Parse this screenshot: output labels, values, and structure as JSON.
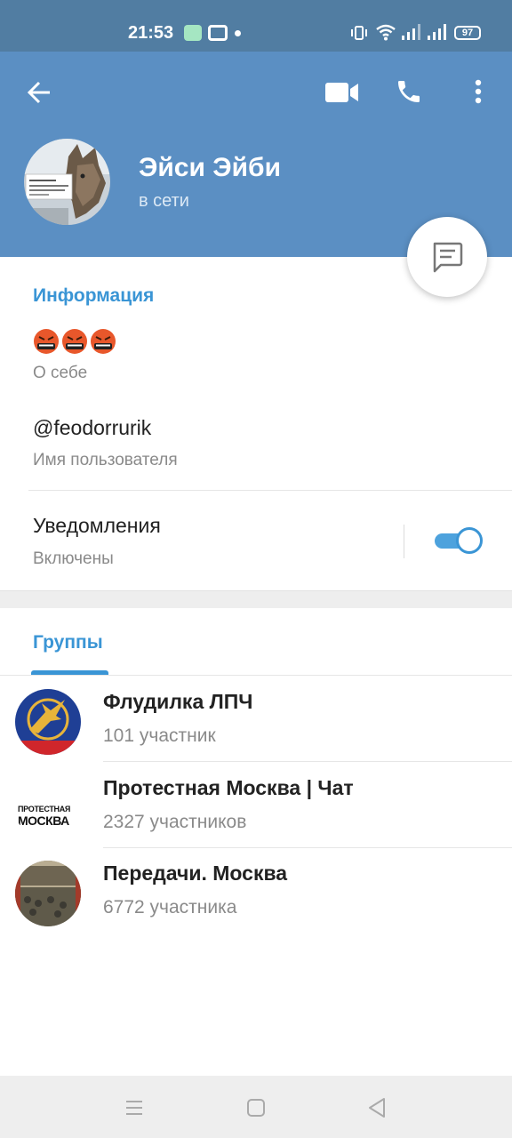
{
  "status_bar": {
    "time": "21:53",
    "battery": "97",
    "icons": [
      "app-notification-icon",
      "app-notification-icon",
      "dot-icon",
      "vibrate-icon",
      "wifi-icon",
      "signal-icon",
      "signal-icon",
      "battery-icon"
    ]
  },
  "header": {
    "icons": [
      "arrow-left-icon",
      "video-camera-icon",
      "phone-icon",
      "more-vertical-icon"
    ],
    "name": "Эйси Эйби",
    "status": "в сети",
    "avatar_icon": "wolf-photo-avatar",
    "fab_icon": "message-icon"
  },
  "info": {
    "title": "Информация",
    "bio_emojis": [
      "angry-face-emoji",
      "angry-face-emoji",
      "angry-face-emoji"
    ],
    "bio_label": "О себе",
    "username": "@feodorrurik",
    "username_label": "Имя пользователя",
    "notifications": "Уведомления",
    "notifications_status": "Включены",
    "notifications_on": true
  },
  "groups": {
    "tab_label": "Группы",
    "items": [
      {
        "name": "Флудилка ЛПЧ",
        "members": "101 участник",
        "avatar": "eagle-logo-avatar"
      },
      {
        "name": "Протестная Москва | Чат",
        "members": "2327 участников",
        "avatar": "text-logo-avatar",
        "logo_text": [
          "ПРОТЕСТНАЯ",
          "МОСКВА"
        ]
      },
      {
        "name": "Передачи. Москва",
        "members": "6772 участника",
        "avatar": "photo-avatar"
      }
    ]
  },
  "nav": {
    "icons": [
      "menu-icon",
      "home-square-icon",
      "back-triangle-icon"
    ]
  },
  "colors": {
    "header": "#5b8fc3",
    "statusbar": "#517da2",
    "accent": "#3a95d5"
  }
}
